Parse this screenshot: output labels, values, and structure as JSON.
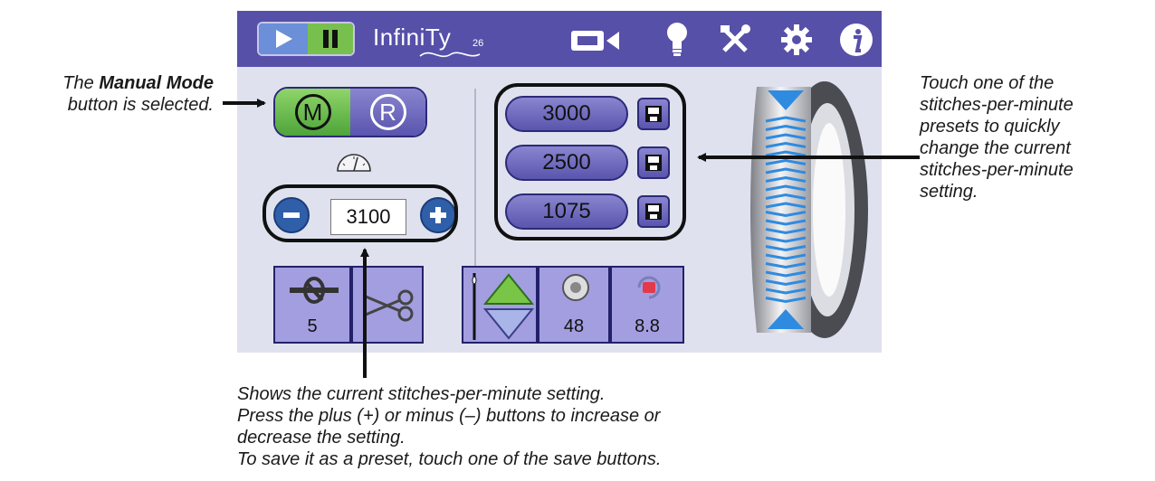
{
  "app": {
    "logo_text": "InfiniTy",
    "logo_number": "26"
  },
  "toolbar": {
    "icons": [
      "play-icon",
      "pause-icon",
      "video-camera-icon",
      "light-bulb-icon",
      "tools-icon",
      "gear-icon",
      "info-icon"
    ]
  },
  "mode": {
    "manual_label": "M",
    "repeat_label": "R",
    "selected": "M"
  },
  "speed": {
    "current_value": "3100"
  },
  "presets": [
    {
      "value": "3000"
    },
    {
      "value": "2500"
    },
    {
      "value": "1075"
    }
  ],
  "bottom_tiles": {
    "tie_off_value": "5",
    "bobbin_value": "48",
    "bobbin_amount_value": "8.8"
  },
  "callouts": {
    "manual_mode_pre": "The ",
    "manual_mode_bold": "Manual Mode",
    "manual_mode_line2": "button is selected.",
    "presets_lines": [
      "Touch one of the",
      "stitches-per-minute",
      "presets to quickly",
      "change the current",
      "stitches-per-minute",
      "setting."
    ],
    "current_lines": [
      "Shows the current stitches-per-minute setting.",
      "Press the plus (+) or minus (–) buttons to increase or",
      "decrease the setting.",
      "To save it as a preset, touch one of the save buttons."
    ]
  },
  "colors": {
    "toolbar": "#5750a9",
    "screen_bg": "#dfe2ee",
    "button": "#6f6ac0",
    "selected": "#6cc04a",
    "wheel_arrow": "#2f8be0"
  }
}
